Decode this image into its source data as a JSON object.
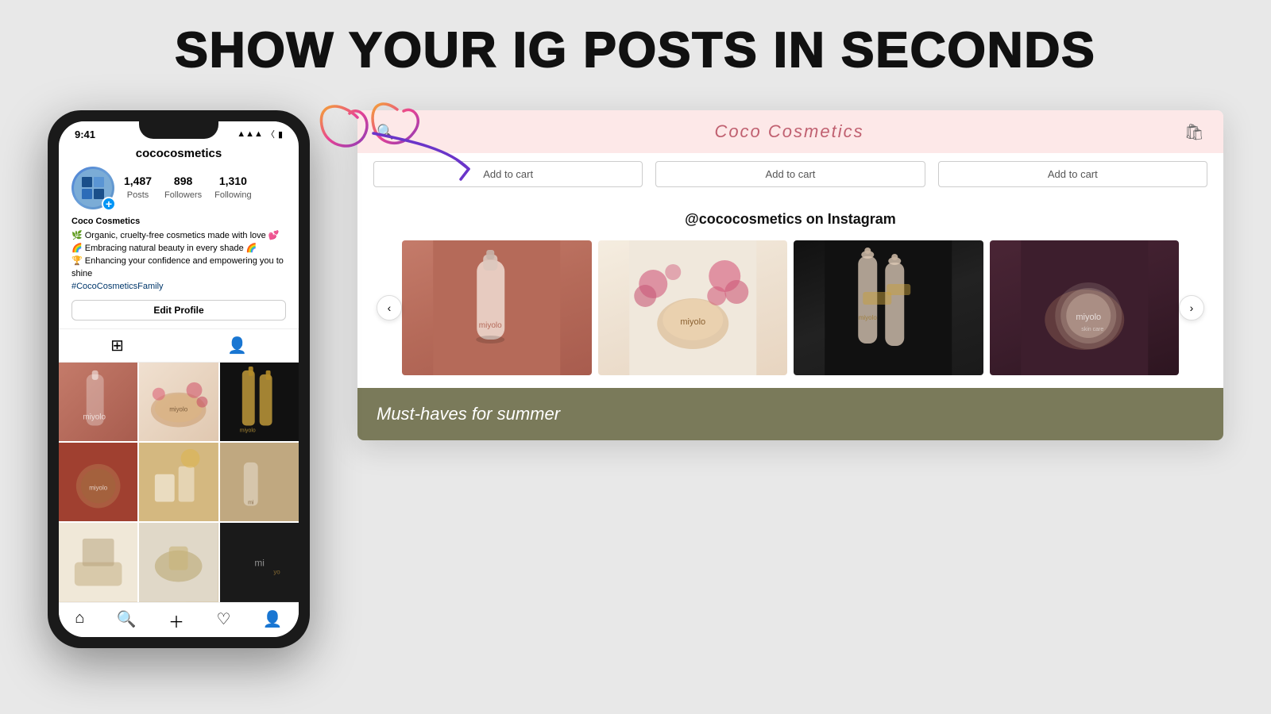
{
  "page": {
    "headline": "SHOW YOUR IG POSTS IN SECONDS",
    "bg_color": "#e8e8e8"
  },
  "phone": {
    "time": "9:41",
    "signal_icon": "▲▲▲",
    "wifi_icon": "wifi",
    "battery_icon": "battery",
    "username": "cococosmetics",
    "stats": [
      {
        "value": "1,487",
        "label": "Posts"
      },
      {
        "value": "898",
        "label": "Followers"
      },
      {
        "value": "1,310",
        "label": "Following"
      }
    ],
    "bio_name": "Coco Cosmetics",
    "bio_line1": "🌿 Organic, cruelty-free cosmetics made with love 💕",
    "bio_line2": "🌈 Embracing natural beauty in every shade 🌈",
    "bio_line3": "🏆 Enhancing your confidence and empowering you to shine",
    "bio_hashtag": "#CocoCosmeticsFamily",
    "edit_profile_label": "Edit Profile",
    "tab_grid_label": "grid",
    "tab_person_label": "person",
    "nav": {
      "home": "🏠",
      "search": "🔍",
      "plus": "➕",
      "heart": "🤍",
      "person": "👤"
    }
  },
  "browser": {
    "search_icon": "🔍",
    "shop_title": "Coco Cosmetics",
    "cart_icon": "🛍",
    "add_to_cart_labels": [
      "Add to cart",
      "Add to cart",
      "Add to cart"
    ],
    "ig_section_title": "@cococosmetics on Instagram",
    "carousel_prev": "‹",
    "carousel_next": "›",
    "must_haves_title": "Must-haves for summer"
  },
  "arrow": {
    "description": "decorative arrow from phone to browser"
  }
}
